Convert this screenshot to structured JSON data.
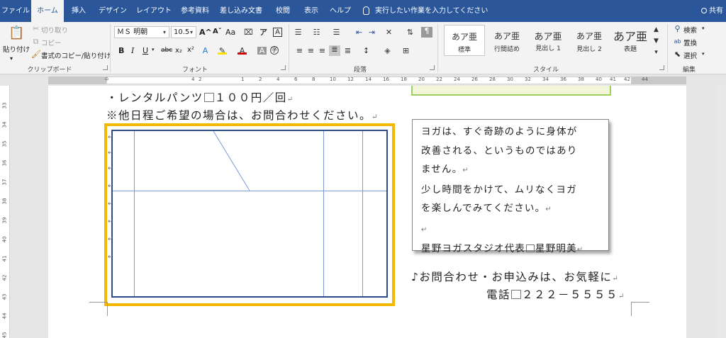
{
  "tabs": [
    "ファイル",
    "ホーム",
    "挿入",
    "デザイン",
    "レイアウト",
    "参考資料",
    "差し込み文書",
    "校閲",
    "表示",
    "ヘルプ"
  ],
  "active_tab": "ホーム",
  "tell_me": "実行したい作業を入力してください",
  "share": "共有",
  "clipboard": {
    "paste": "貼り付け",
    "cut": "切り取り",
    "copy": "コピー",
    "format_painter": "書式のコピー/貼り付け",
    "label": "クリップボード"
  },
  "font": {
    "name": "ＭＳ 明朝",
    "size": "10.5",
    "grow_icon": "A^",
    "shrink_icon": "Aˇ",
    "case": "Aa",
    "bold": "B",
    "italic": "I",
    "underline": "U",
    "strike": "abc",
    "subscript": "x₂",
    "superscript": "x²",
    "label": "フォント"
  },
  "paragraph": {
    "label": "段落"
  },
  "styles": {
    "label": "スタイル",
    "items": [
      {
        "sample": "あア亜",
        "name": "標準"
      },
      {
        "sample": "あア亜",
        "name": "行間詰め"
      },
      {
        "sample": "あア亜",
        "name": "見出し 1"
      },
      {
        "sample": "あア亜",
        "name": "見出し 2"
      },
      {
        "sample": "あア亜",
        "name": "表題"
      }
    ]
  },
  "editing": {
    "find": "検索",
    "replace": "置換",
    "select": "選択",
    "label": "編集"
  },
  "ruler": {
    "h": [
      "4",
      "2",
      "1",
      "2",
      "4",
      "6",
      "8",
      "10",
      "12",
      "14",
      "16",
      "18",
      "20",
      "22",
      "24",
      "26",
      "28",
      "30",
      "32",
      "34",
      "36",
      "38",
      "40",
      "41",
      "42",
      "44"
    ],
    "v": [
      "33",
      "34",
      "35",
      "36",
      "37",
      "38",
      "39",
      "40",
      "41",
      "42",
      "43",
      "44",
      "45"
    ]
  },
  "document": {
    "line1_a": "・レンタルパンツ",
    "line1_b": "１００円／回",
    "line2": "※他日程ご希望の場合は、お問合わせください。",
    "contact1": "♪お問合わせ・お申込みは、お気軽に",
    "contact2_a": "電話",
    "contact2_b": "２２２－５５５５",
    "para_mark": "↵"
  },
  "textbox": {
    "line1": "ヨガは、すぐ奇跡のように身体が",
    "line2": "改善される、というものではあり",
    "line3": "ません。",
    "line4": "少し時間をかけて、ムリなくヨガ",
    "line5": "を楽しんでみてください。",
    "line6": "",
    "line7_a": "星野ヨガスタジオ代表",
    "line7_b": "星野明美"
  },
  "colors": {
    "ribbon_blue": "#2b579a",
    "highlight": "#f5b800",
    "table_border": "#2e4b8a",
    "table_lines": "#7a9ad8"
  }
}
